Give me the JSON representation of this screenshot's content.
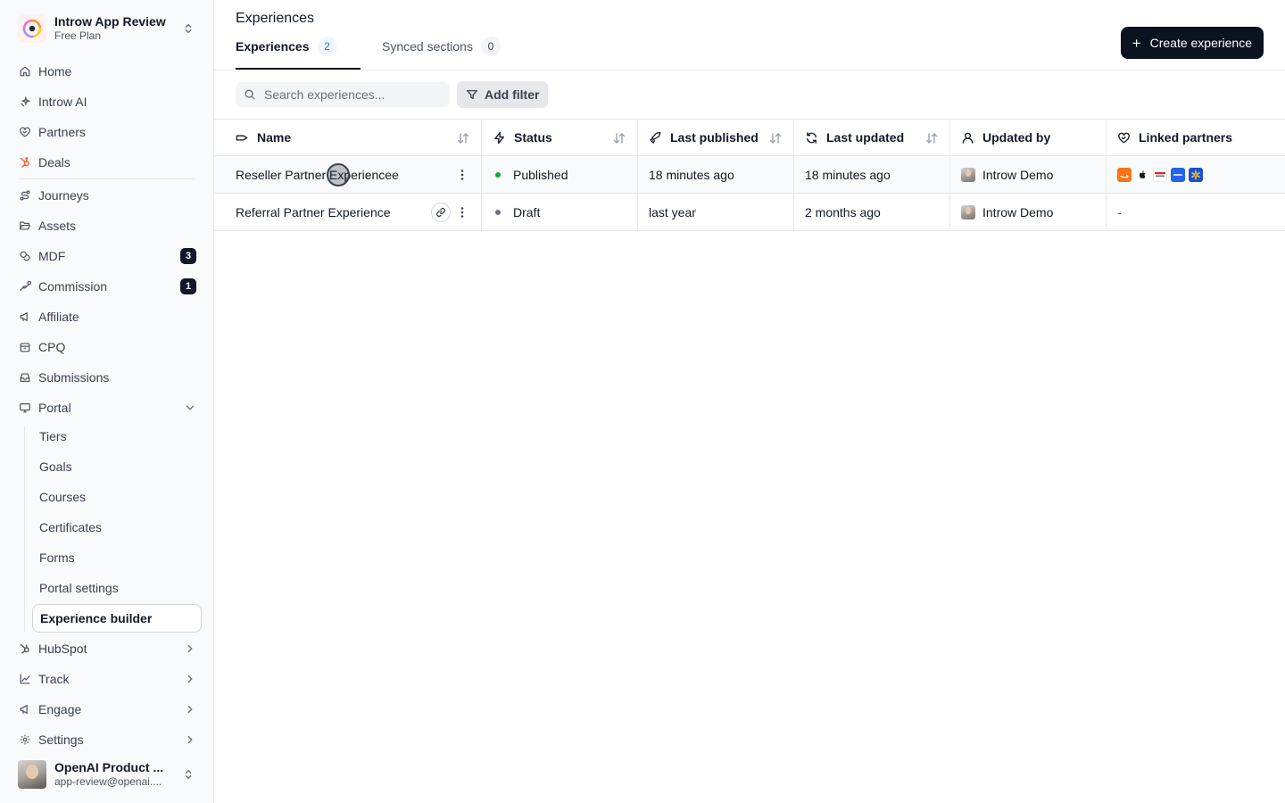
{
  "workspace": {
    "name": "Introw App Review",
    "plan": "Free Plan"
  },
  "nav": {
    "home": "Home",
    "ai": "Introw AI",
    "partners": "Partners",
    "deals": "Deals",
    "journeys": "Journeys",
    "assets": "Assets",
    "mdf": "MDF",
    "mdf_badge": "3",
    "commission": "Commission",
    "commission_badge": "1",
    "affiliate": "Affiliate",
    "cpq": "CPQ",
    "submissions": "Submissions",
    "portal": "Portal",
    "portal_sub": {
      "tiers": "Tiers",
      "goals": "Goals",
      "courses": "Courses",
      "certificates": "Certificates",
      "forms": "Forms",
      "portal_settings": "Portal settings",
      "experience_builder": "Experience builder"
    },
    "hubspot": "HubSpot",
    "track": "Track",
    "engage": "Engage",
    "settings": "Settings"
  },
  "user": {
    "name": "OpenAI Product ...",
    "email": "app-review@openai...."
  },
  "header": {
    "title": "Experiences",
    "create_label": "Create experience",
    "tabs": [
      {
        "label": "Experiences",
        "count": "2"
      },
      {
        "label": "Synced sections",
        "count": "0"
      }
    ]
  },
  "toolbar": {
    "search_placeholder": "Search experiences...",
    "filter_label": "Add filter"
  },
  "table": {
    "columns": {
      "name": "Name",
      "status": "Status",
      "last_published": "Last published",
      "last_updated": "Last updated",
      "updated_by": "Updated by",
      "linked_partners": "Linked partners"
    },
    "rows": [
      {
        "name": "Reseller Partner Experiencee",
        "status": "Published",
        "last_published": "18 minutes ago",
        "last_updated": "18 minutes ago",
        "updated_by": "Introw Demo",
        "linked_partners": ""
      },
      {
        "name": "Referral Partner Experience",
        "status": "Draft",
        "last_published": "last year",
        "last_updated": "2 months ago",
        "updated_by": "Introw Demo",
        "linked_partners": "-"
      }
    ]
  },
  "colors": {
    "primary": "#0b1220",
    "published": "#16a34a",
    "draft": "#6b7280",
    "hubspot": "#ff5c35"
  }
}
